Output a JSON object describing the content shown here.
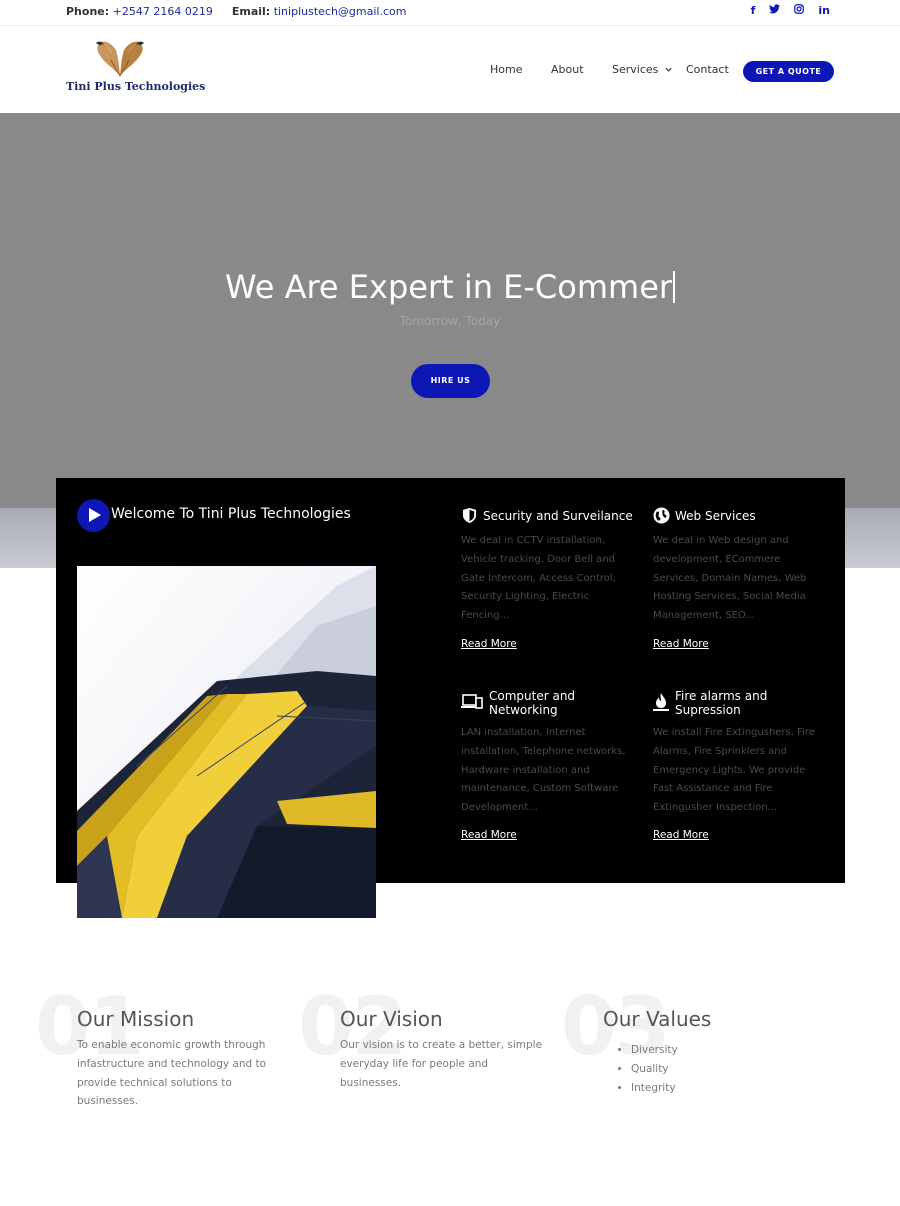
{
  "topbar": {
    "phone_label": "Phone:",
    "phone": "+2547 2164 0219",
    "email_label": "Email:",
    "email": "tiniplustech@gmail.com",
    "social": [
      "facebook-icon",
      "twitter-icon",
      "instagram-icon",
      "linkedin-icon"
    ]
  },
  "header": {
    "brand": "Tini Plus Technologies",
    "nav": [
      "Home",
      "About",
      "Services",
      "Contact"
    ],
    "quote_label": "GET A QUOTE"
  },
  "hero": {
    "title": "We Are Expert in E-Commer",
    "subtitle": "Tomorrow, Today",
    "button": "HIRE US"
  },
  "welcome": {
    "title": "Welcome To Tini Plus Technologies"
  },
  "services": [
    {
      "title": "Security and Surveilance",
      "icon": "shield-icon",
      "description": "We deal in CCTV installation, Vehicle tracking, Door Bell and Gate Intercom, Access Control, Security Lighting, Electric Fencing...",
      "link": "Read More"
    },
    {
      "title": "Web Services",
      "icon": "globe-icon",
      "description": "We deal in Web design and development, ECommere Services, Domain Names, Web Hosting Services, Social Media Management, SEO...",
      "link": "Read More"
    },
    {
      "title": "Computer and Networking",
      "icon": "devices-icon",
      "description": "LAN installation, Internet installation, Telephone networks, Hardware installation and maintenance, Custom Software Development...",
      "link": "Read More"
    },
    {
      "title": "Fire alarms and Supression",
      "icon": "fire-icon",
      "description": "We install Fire Extingushers, Fire Alarms, Fire Sprinklers and Emergency Lights. We provide Fast Assistance and Fire Extingusher Inspection...",
      "link": "Read More"
    }
  ],
  "features": [
    {
      "number": "01",
      "title": "Our Mission",
      "text": "To enable economic growth through infastructure and technology and to provide technical solutions to businesses."
    },
    {
      "number": "02",
      "title": "Our Vision",
      "text": "Our vision is to create a better, simple everyday life for people and businesses."
    },
    {
      "number": "03",
      "title": "Our Values",
      "items": [
        "Diversity",
        "Quality",
        "Integrity"
      ]
    }
  ],
  "colors": {
    "accent": "#0d17b5",
    "hero_bg": "#898989",
    "panel_bg": "#000000"
  }
}
